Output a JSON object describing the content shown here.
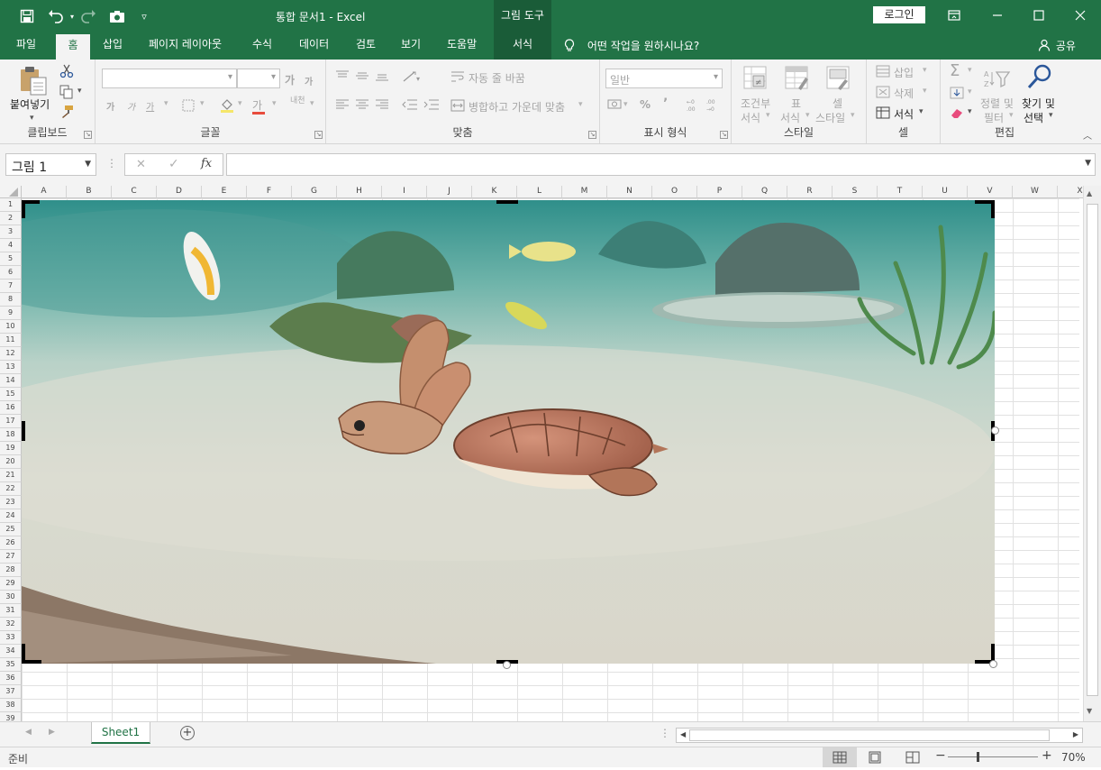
{
  "window": {
    "title": "통합 문서1  -  Excel",
    "context_tool": "그림 도구",
    "login": "로그인"
  },
  "tabs": [
    {
      "label": "파일"
    },
    {
      "label": "홈"
    },
    {
      "label": "삽입"
    },
    {
      "label": "페이지 레이아웃"
    },
    {
      "label": "수식"
    },
    {
      "label": "데이터"
    },
    {
      "label": "검토"
    },
    {
      "label": "보기"
    },
    {
      "label": "도움말"
    },
    {
      "label": "서식"
    }
  ],
  "tell_me": "어떤 작업을 원하시나요?",
  "share": "공유",
  "ribbon": {
    "clipboard": {
      "paste": "붙여넣기",
      "label": "클립보드"
    },
    "font": {
      "label": "글꼴",
      "grow": "가",
      "shrink": "가",
      "bold": "가",
      "italic": "가",
      "underline": "가",
      "color": "가",
      "phonetic": "내천"
    },
    "alignment": {
      "wrap": "자동 줄 바꿈",
      "merge": "병합하고 가운데 맞춤",
      "label": "맞춤"
    },
    "number": {
      "format": "일반",
      "percent": "%",
      "comma": "’",
      "label": "표시 형식"
    },
    "styles": {
      "conditional_1": "조건부",
      "conditional_2": "서식",
      "table_1": "표",
      "table_2": "서식",
      "cell_1": "셀",
      "cell_2": "스타일",
      "label": "스타일"
    },
    "cells": {
      "insert": "삽입",
      "delete": "삭제",
      "format": "서식",
      "label": "셀"
    },
    "editing": {
      "sort_1": "정렬 및",
      "sort_2": "필터",
      "find_1": "찾기 및",
      "find_2": "선택",
      "label": "편집"
    }
  },
  "formula_bar": {
    "name_box": "그림 1",
    "fx": "fx"
  },
  "columns": [
    "A",
    "B",
    "C",
    "D",
    "E",
    "F",
    "G",
    "H",
    "I",
    "J",
    "K",
    "L",
    "M",
    "N",
    "O",
    "P",
    "Q",
    "R",
    "S",
    "T",
    "U",
    "V",
    "W",
    "X"
  ],
  "rows": [
    "1",
    "2",
    "3",
    "4",
    "5",
    "6",
    "7",
    "8",
    "9",
    "10",
    "11",
    "12",
    "13",
    "14",
    "15",
    "16",
    "17",
    "18",
    "19",
    "20",
    "21",
    "22",
    "23",
    "24",
    "25",
    "26",
    "27",
    "28",
    "29",
    "30",
    "31",
    "32",
    "33",
    "34",
    "35",
    "36",
    "37",
    "38",
    "39"
  ],
  "sheet": {
    "name": "Sheet1"
  },
  "status": {
    "ready": "준비",
    "zoom": "70%"
  },
  "colors": {
    "brand": "#217346",
    "ribbon_bg": "#f3f3f3"
  }
}
